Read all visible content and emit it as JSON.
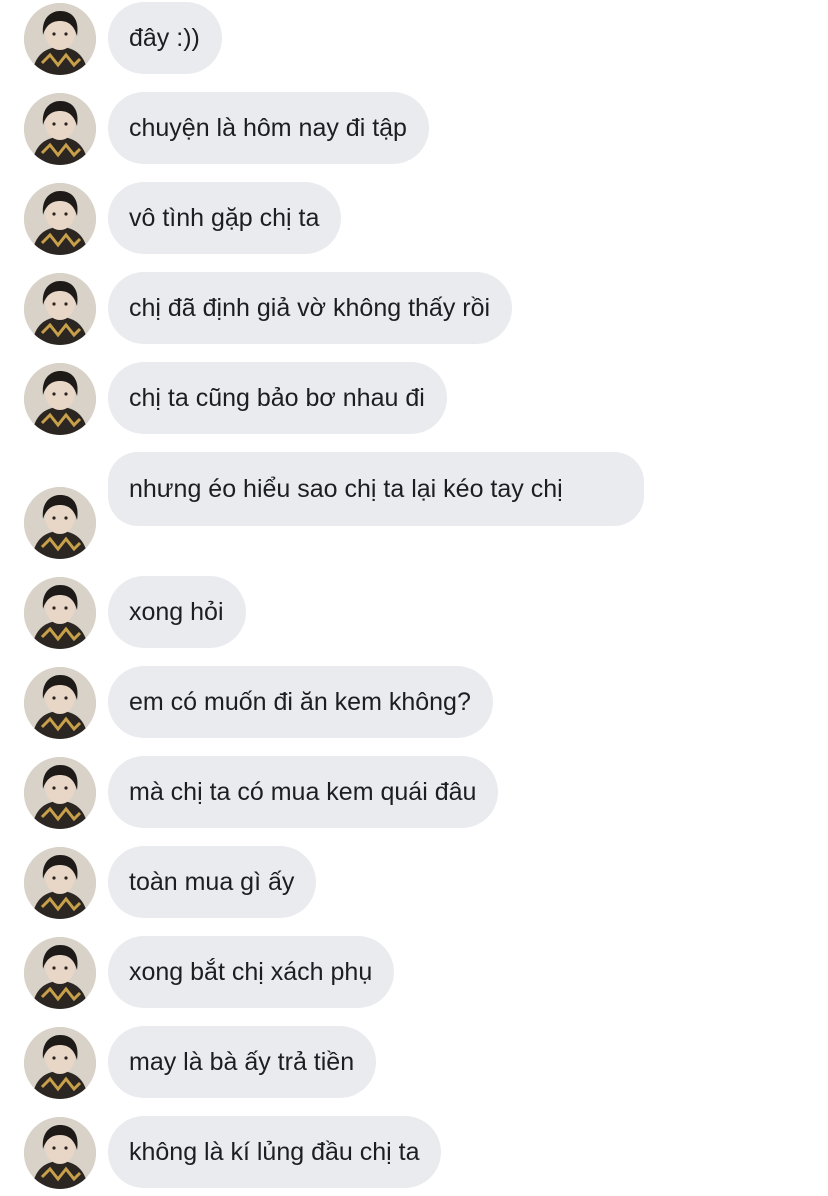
{
  "conversation": {
    "messages": [
      {
        "text": "đây :))"
      },
      {
        "text": "chuyện là hôm nay đi tập"
      },
      {
        "text": "vô tình gặp chị ta"
      },
      {
        "text": "chị đã định giả vờ không thấy rồi"
      },
      {
        "text": "chị ta cũng bảo bơ nhau đi"
      },
      {
        "text": "nhưng éo hiểu sao chị ta lại kéo tay chị"
      },
      {
        "text": "xong hỏi"
      },
      {
        "text": "em có muốn đi ăn kem không?"
      },
      {
        "text": "mà chị ta có mua kem quái đâu"
      },
      {
        "text": "toàn mua gì ấy"
      },
      {
        "text": "xong bắt chị xách phụ"
      },
      {
        "text": "may là bà ấy trả tiền"
      },
      {
        "text": "không là kí lủng đầu chị ta"
      }
    ]
  },
  "colors": {
    "bubble_background": "#e9ebef",
    "bubble_text": "#1c1e21",
    "page_background": "#ffffff"
  },
  "icons": {
    "avatar": "profile-photo-avatar"
  }
}
